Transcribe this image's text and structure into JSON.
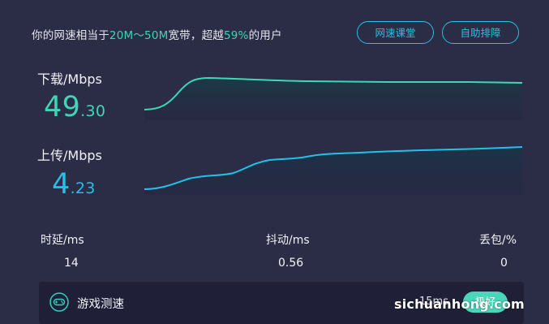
{
  "header": {
    "prefix": "你的网速相当于",
    "range": "20M～50M",
    "middle": "宽带，超越",
    "percent": "59%",
    "suffix": "的用户",
    "course_button": "网速课堂",
    "help_button": "自助排障"
  },
  "download": {
    "label": "下载/Mbps",
    "int": "49",
    "dec": ".30"
  },
  "upload": {
    "label": "上传/Mbps",
    "int": "4",
    "dec": ".23"
  },
  "stats": {
    "latency_label": "时延/ms",
    "latency_value": "14",
    "jitter_label": "抖动/ms",
    "jitter_value": "0.56",
    "loss_label": "丢包/%",
    "loss_value": "0"
  },
  "game": {
    "icon": "gamepad-icon",
    "label": "游戏测速",
    "latency": "15ms",
    "status": "极好"
  },
  "watermark": "sichuanhong.com",
  "colors": {
    "background": "#2b2c45",
    "accent_green": "#3fd6b7",
    "accent_blue": "#20c2ea"
  }
}
